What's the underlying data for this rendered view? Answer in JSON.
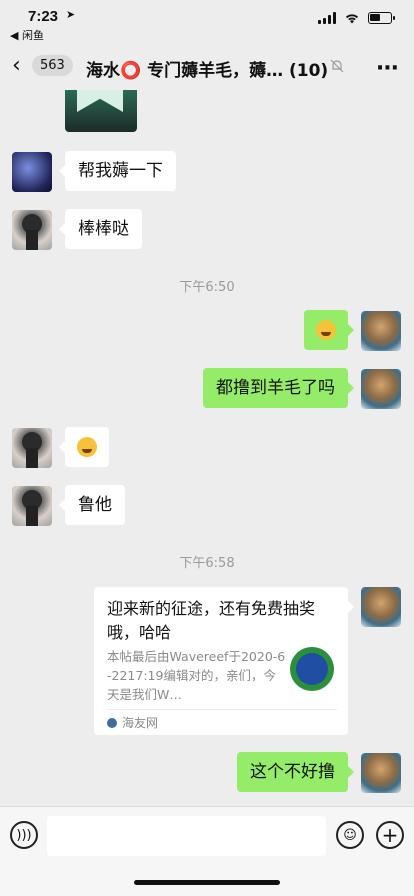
{
  "status_bar": {
    "time": "7:23",
    "back_app": "◀ 闲鱼"
  },
  "header": {
    "unread_count": "563",
    "title": "海水⭕ 专门薅羊毛，薅… (10)"
  },
  "messages": [
    {
      "side": "left",
      "avatar": "blue",
      "text": "帮我薅一下"
    },
    {
      "side": "left",
      "avatar": "dark",
      "text": "棒棒哒"
    },
    {
      "type": "time",
      "text": "下午6:50"
    },
    {
      "side": "right",
      "avatar": "self",
      "emoji": "smile-emoji"
    },
    {
      "side": "right",
      "avatar": "self",
      "text": "都撸到羊毛了吗"
    },
    {
      "side": "left",
      "avatar": "dark",
      "emoji": "grin-emoji"
    },
    {
      "side": "left",
      "avatar": "dark",
      "text": "鲁他"
    },
    {
      "type": "time",
      "text": "下午6:58"
    },
    {
      "side": "right",
      "avatar": "self",
      "text": "这个不好撸"
    }
  ],
  "link_card": {
    "title": "迎来新的征途，还有免费抽奖哦，哈哈",
    "description": "本帖最后由Wavereef于2020-6-2217:19编辑对的，亲们，今天是我们W…",
    "source": "海友网"
  },
  "input_bar": {
    "placeholder": ""
  }
}
